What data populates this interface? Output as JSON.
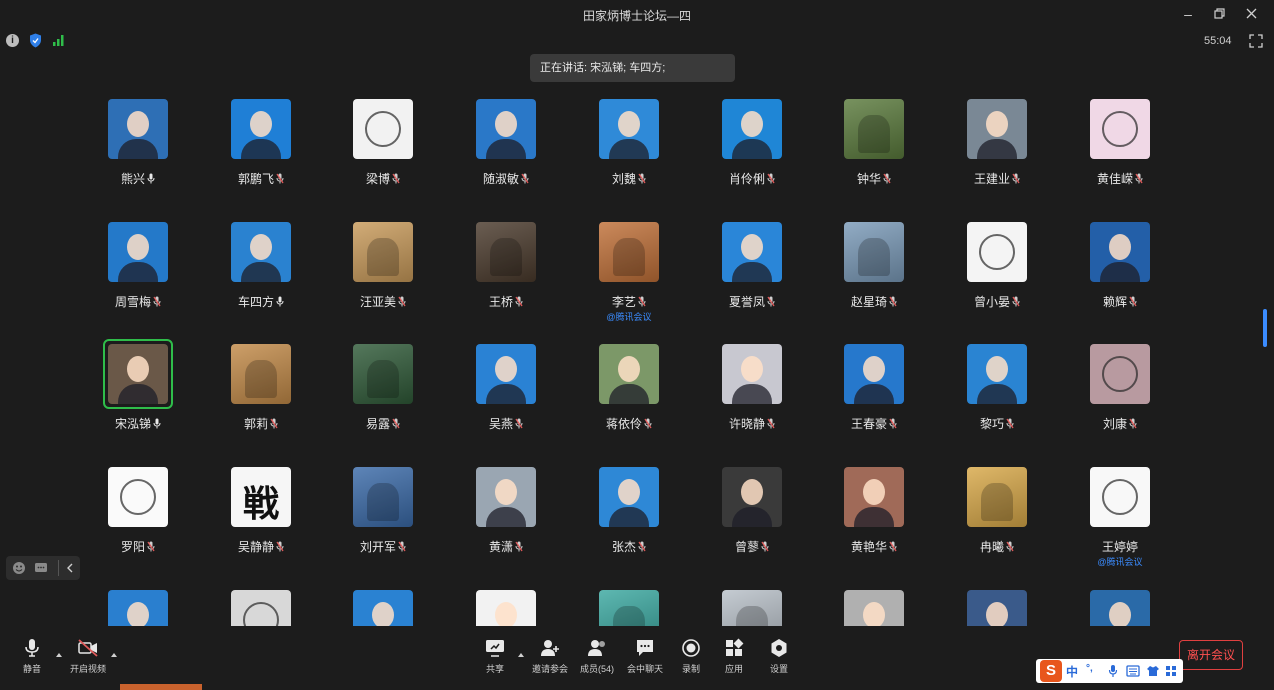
{
  "window": {
    "title": "田家炳博士论坛—四"
  },
  "header": {
    "timer": "55:04"
  },
  "speaking": {
    "label": "正在讲话: 宋泓锑; 车四方;"
  },
  "participants": [
    {
      "name": "熊兴",
      "mic": "on",
      "avatar_color": "#2e6fb5",
      "avatar_kind": "person"
    },
    {
      "name": "郭鹏飞",
      "mic": "muted",
      "avatar_color": "#1f7fd6",
      "avatar_kind": "person"
    },
    {
      "name": "梁博",
      "mic": "muted",
      "avatar_color": "#f2f2f2",
      "avatar_kind": "cartoon"
    },
    {
      "name": "随淑敏",
      "mic": "muted",
      "avatar_color": "#2a78c8",
      "avatar_kind": "person"
    },
    {
      "name": "刘魏",
      "mic": "muted",
      "avatar_color": "#2f8ad8",
      "avatar_kind": "person"
    },
    {
      "name": "肖伶俐",
      "mic": "muted",
      "avatar_color": "#1f86d6",
      "avatar_kind": "person"
    },
    {
      "name": "钟华",
      "mic": "muted",
      "avatar_color": "#5a7a3c",
      "avatar_kind": "photo"
    },
    {
      "name": "王建业",
      "mic": "muted",
      "avatar_color": "#7a8895",
      "avatar_kind": "person"
    },
    {
      "name": "黄佳嵘",
      "mic": "muted",
      "avatar_color": "#f0d8e6",
      "avatar_kind": "cartoon"
    },
    {
      "name": "周雪梅",
      "mic": "muted",
      "avatar_color": "#2479c9",
      "avatar_kind": "person"
    },
    {
      "name": "车四方",
      "mic": "on",
      "avatar_color": "#2a82d0",
      "avatar_kind": "person"
    },
    {
      "name": "汪亚美",
      "mic": "muted",
      "avatar_color": "#c89a5a",
      "avatar_kind": "photo"
    },
    {
      "name": "王桥",
      "mic": "muted",
      "avatar_color": "#4a3a2c",
      "avatar_kind": "photo"
    },
    {
      "name": "李艺",
      "mic": "muted",
      "avatar_color": "#c07038",
      "avatar_kind": "photo",
      "sub_label": "@腾讯会议"
    },
    {
      "name": "夏誉凤",
      "mic": "muted",
      "avatar_color": "#2a86d8",
      "avatar_kind": "person"
    },
    {
      "name": "赵星琦",
      "mic": "muted",
      "avatar_color": "#7a9ab8",
      "avatar_kind": "photo"
    },
    {
      "name": "曾小晏",
      "mic": "muted",
      "avatar_color": "#f4f4f4",
      "avatar_kind": "cartoon"
    },
    {
      "name": "赖辉",
      "mic": "muted",
      "avatar_color": "#235fa8",
      "avatar_kind": "person"
    },
    {
      "name": "宋泓锑",
      "mic": "on",
      "avatar_color": "#6a5848",
      "avatar_kind": "person",
      "active": true
    },
    {
      "name": "郭莉",
      "mic": "muted",
      "avatar_color": "#c28a48",
      "avatar_kind": "photo"
    },
    {
      "name": "易露",
      "mic": "muted",
      "avatar_color": "#2f5a38",
      "avatar_kind": "photo"
    },
    {
      "name": "吴燕",
      "mic": "muted",
      "avatar_color": "#2a82d4",
      "avatar_kind": "person"
    },
    {
      "name": "蒋依伶",
      "mic": "muted",
      "avatar_color": "#7c9868",
      "avatar_kind": "person"
    },
    {
      "name": "许晓静",
      "mic": "muted",
      "avatar_color": "#c8c8d0",
      "avatar_kind": "person"
    },
    {
      "name": "王春豪",
      "mic": "muted",
      "avatar_color": "#2678cc",
      "avatar_kind": "person"
    },
    {
      "name": "黎巧",
      "mic": "muted",
      "avatar_color": "#2a84d2",
      "avatar_kind": "person"
    },
    {
      "name": "刘康",
      "mic": "muted",
      "avatar_color": "#b89aa0",
      "avatar_kind": "cartoon"
    },
    {
      "name": "罗阳",
      "mic": "muted",
      "avatar_color": "#fafafa",
      "avatar_kind": "cartoon"
    },
    {
      "name": "吴静静",
      "mic": "muted",
      "avatar_color": "#f6f6f6",
      "avatar_kind": "cartoon",
      "glyph": "戦"
    },
    {
      "name": "刘开军",
      "mic": "muted",
      "avatar_color": "#3a6aa8",
      "avatar_kind": "photo"
    },
    {
      "name": "黄潇",
      "mic": "muted",
      "avatar_color": "#9aa6b2",
      "avatar_kind": "person"
    },
    {
      "name": "张杰",
      "mic": "muted",
      "avatar_color": "#2e88d6",
      "avatar_kind": "person"
    },
    {
      "name": "曾蓼",
      "mic": "muted",
      "avatar_color": "#3a3a3a",
      "avatar_kind": "person"
    },
    {
      "name": "黄艳华",
      "mic": "muted",
      "avatar_color": "#a06a58",
      "avatar_kind": "person"
    },
    {
      "name": "冉曦",
      "mic": "muted",
      "avatar_color": "#d8a848",
      "avatar_kind": "photo"
    },
    {
      "name": "王婷婷",
      "mic": "none",
      "avatar_color": "#f8f8f8",
      "avatar_kind": "cartoon",
      "sub_label": "@腾讯会议"
    },
    {
      "name": "",
      "mic": "none",
      "avatar_color": "#2a7fcf",
      "avatar_kind": "person"
    },
    {
      "name": "",
      "mic": "none",
      "avatar_color": "#d8d8d8",
      "avatar_kind": "cartoon"
    },
    {
      "name": "",
      "mic": "none",
      "avatar_color": "#2a82d2",
      "avatar_kind": "person"
    },
    {
      "name": "",
      "mic": "none",
      "avatar_color": "#f2f2f2",
      "avatar_kind": "person"
    },
    {
      "name": "",
      "mic": "none",
      "avatar_color": "#3aa8a0",
      "avatar_kind": "photo"
    },
    {
      "name": "",
      "mic": "none",
      "avatar_color": "#b8c0c8",
      "avatar_kind": "photo"
    },
    {
      "name": "",
      "mic": "none",
      "avatar_color": "#b0b0b0",
      "avatar_kind": "person"
    },
    {
      "name": "",
      "mic": "none",
      "avatar_color": "#3a5a8a",
      "avatar_kind": "person"
    },
    {
      "name": "",
      "mic": "none",
      "avatar_color": "#2a6aa8",
      "avatar_kind": "person"
    }
  ],
  "toolbar": {
    "mute_label": "静音",
    "video_label": "开启视频",
    "share_label": "共享",
    "invite_label": "邀请参会",
    "members_label": "成员(54)",
    "chat_label": "会中聊天",
    "record_label": "录制",
    "apps_label": "应用",
    "settings_label": "设置",
    "leave_label": "离开会议"
  },
  "ime": {
    "logo": "S",
    "mode": "中",
    "punct": "°,"
  },
  "colors": {
    "muted_mic": "#e05a5a",
    "accent": "#3b8cff",
    "active_ring": "#2fbd4a",
    "leave": "#e04040"
  }
}
